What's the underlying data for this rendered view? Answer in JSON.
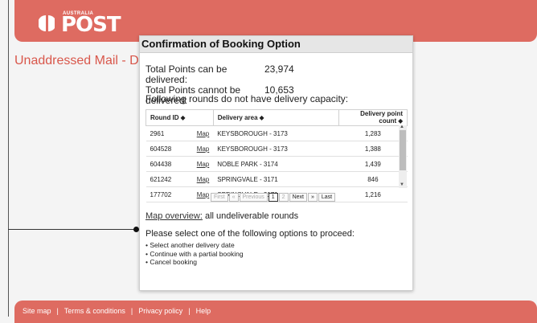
{
  "brand": {
    "small": "AUSTRALIA",
    "name": "POST"
  },
  "page_title": "Unaddressed Mail - D",
  "modal": {
    "title": "Confirmation of Booking Option",
    "totals": [
      {
        "label": "Total Points can be delivered:",
        "value": "23,974"
      },
      {
        "label": "Total Points cannot be delivered:",
        "value": "10,653"
      }
    ],
    "subhead": "Following rounds do not have delivery capacity:",
    "table": {
      "headers": [
        "Round ID ⬥",
        "Delivery area ⬥",
        "Delivery point count ⬥"
      ],
      "map_label": "Map",
      "rows": [
        {
          "id": "2961",
          "area": "KEYSBOROUGH - 3173",
          "count": "1,283"
        },
        {
          "id": "604528",
          "area": "KEYSBOROUGH - 3173",
          "count": "1,388"
        },
        {
          "id": "604438",
          "area": "NOBLE PARK - 3174",
          "count": "1,439"
        },
        {
          "id": "621242",
          "area": "SPRINGVALE - 3171",
          "count": "846"
        },
        {
          "id": "177702",
          "area": "SPRINGVALE - 3171",
          "count": "1,216"
        }
      ]
    },
    "pager": {
      "first": "First",
      "prev_sym": "«",
      "previous": "Previous",
      "page1": "1",
      "page2": "2",
      "next": "Next",
      "next_sym": "»",
      "last": "Last"
    },
    "map_overview_link": "Map overview:",
    "map_overview_text": "all undeliverable rounds",
    "options_head": "Please select one of the following options to proceed:",
    "options": [
      "Select another delivery date",
      "Continue with a partial booking",
      "Cancel booking"
    ]
  },
  "footer": {
    "links": [
      "Site map",
      "Terms & conditions",
      "Privacy policy",
      "Help"
    ]
  },
  "colors": {
    "brand_red": "#de6b61",
    "title_red": "#d9574b"
  }
}
